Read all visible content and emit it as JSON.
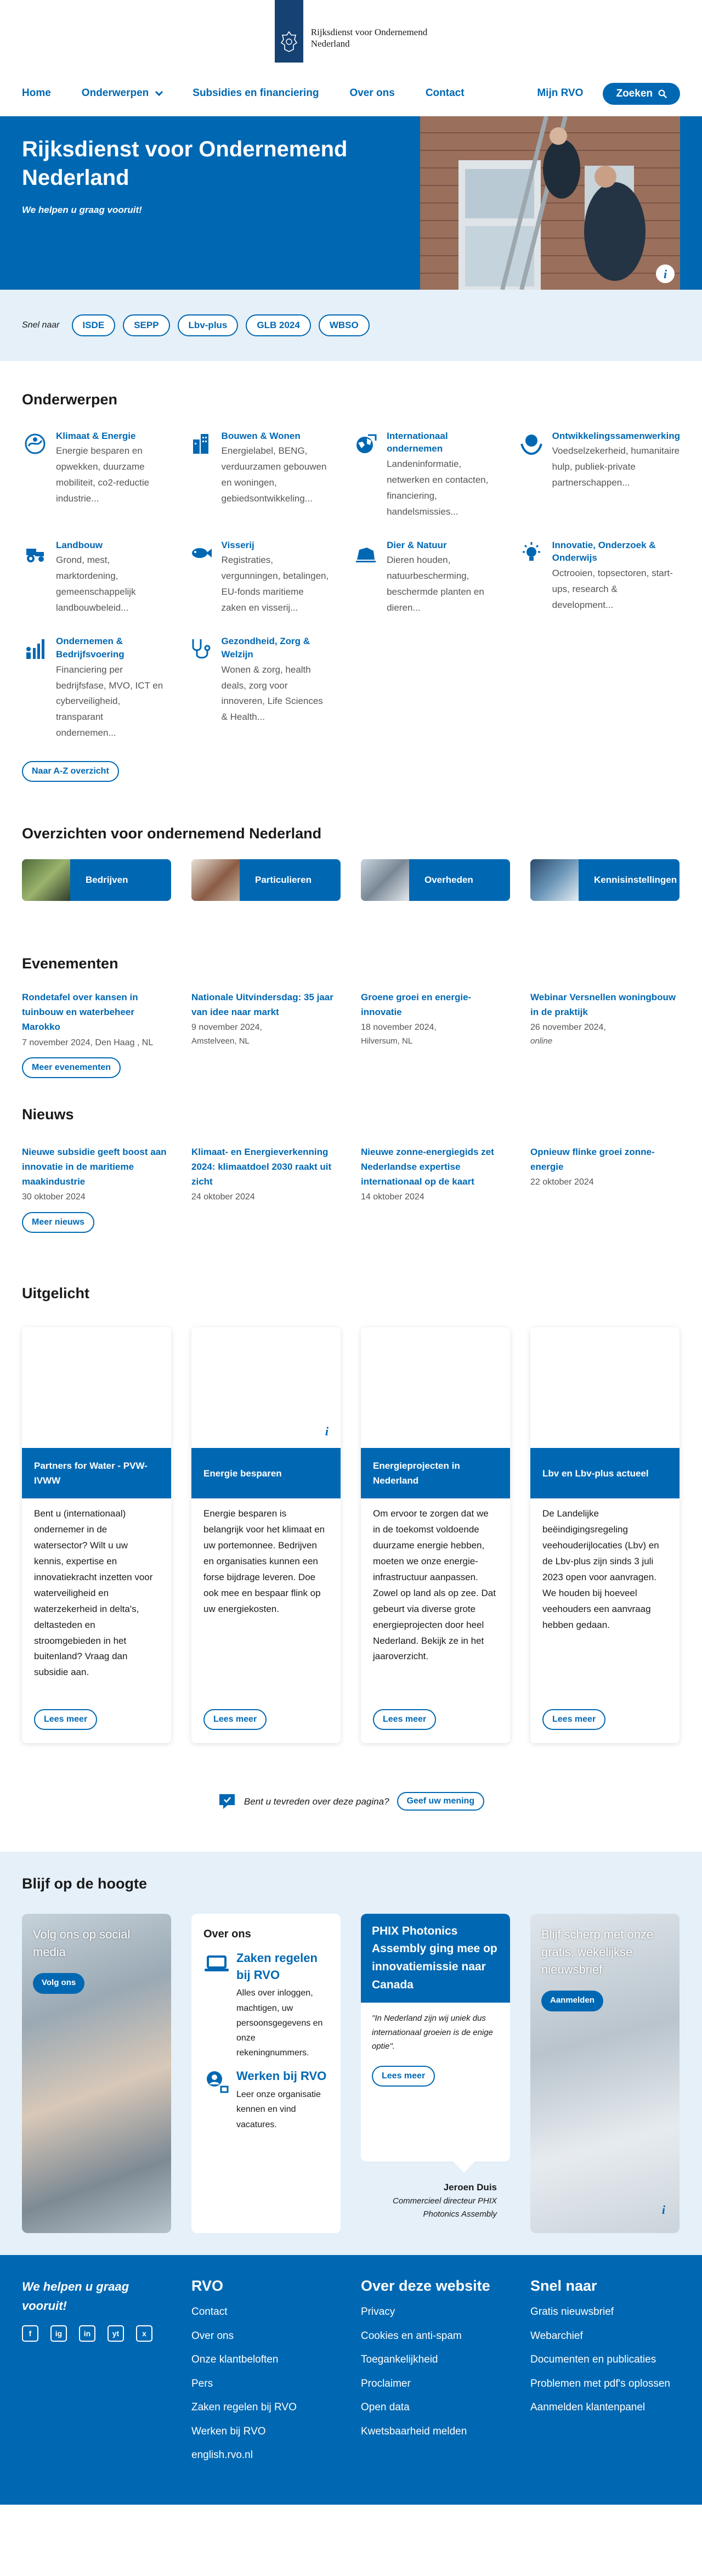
{
  "logo": {
    "line1": "Rijksdienst voor Ondernemend",
    "line2": "Nederland"
  },
  "nav": {
    "items": [
      "Home",
      "Onderwerpen",
      "Subsidies en financiering",
      "Over ons",
      "Contact"
    ],
    "mijn": "Mijn RVO",
    "search": "Zoeken"
  },
  "hero": {
    "title": "Rijksdienst voor Ondernemend Nederland",
    "subtitle": "We helpen u graag vooruit!"
  },
  "snel": {
    "label": "Snel naar",
    "chips": [
      "ISDE",
      "SEPP",
      "Lbv-plus",
      "GLB 2024",
      "WBSO"
    ]
  },
  "topics": {
    "heading": "Onderwerpen",
    "items": [
      {
        "title": "Klimaat & Energie",
        "text": "Energie besparen en opwekken, duurzame mobiliteit, co2-reductie industrie...",
        "icon": "climate-icon"
      },
      {
        "title": "Bouwen & Wonen",
        "text": "Energielabel, BENG, verduurzamen gebouwen en woningen, gebiedsontwikkeling...",
        "icon": "building-icon"
      },
      {
        "title": "Internationaal ondernemen",
        "text": "Landeninformatie, netwerken en contacten, financiering, handelsmissies...",
        "icon": "globe-icon"
      },
      {
        "title": "Ontwikkelingssamenwerking",
        "text": "Voedselzekerheid, humanitaire hulp, publiek-private partnerschappen...",
        "icon": "handshake-globe-icon"
      },
      {
        "title": "Landbouw",
        "text": "Grond, mest, marktordening, gemeenschappelijk landbouwbeleid...",
        "icon": "tractor-icon"
      },
      {
        "title": "Visserij",
        "text": "Registraties, vergunningen, betalingen, EU-fonds maritieme zaken en visserij...",
        "icon": "fish-icon"
      },
      {
        "title": "Dier & Natuur",
        "text": "Dieren houden, natuurbescherming, beschermde planten en dieren...",
        "icon": "animal-icon"
      },
      {
        "title": "Innovatie, Onderzoek & Onderwijs",
        "text": "Octrooien, topsectoren, start-ups, research & development...",
        "icon": "lightbulb-icon"
      },
      {
        "title": "Ondernemen & Bedrijfsvoering",
        "text": "Financiering per bedrijfsfase, MVO, ICT en cyberveiligheid, transparant ondernemen...",
        "icon": "chart-people-icon"
      },
      {
        "title": "Gezondheid, Zorg & Welzijn",
        "text": "Wonen & zorg, health deals, zorg voor innoveren, Life Sciences & Health...",
        "icon": "stethoscope-icon"
      }
    ],
    "more": "Naar A-Z overzicht"
  },
  "overzichten": {
    "heading": "Overzichten voor ondernemend Nederland",
    "items": [
      "Bedrijven",
      "Particulieren",
      "Overheden",
      "Kennisinstellingen"
    ]
  },
  "events": {
    "heading": "Evenementen",
    "items": [
      {
        "title": "Rondetafel over kansen in tuinbouw en waterbeheer Marokko",
        "date": "7 november 2024, Den Haag , NL",
        "loc": "",
        "italic": false
      },
      {
        "title": "Nationale Uitvindersdag: 35 jaar van idee naar markt",
        "date": "9 november 2024,",
        "loc": "Amstelveen, NL",
        "italic": false
      },
      {
        "title": "Groene groei en energie-innovatie",
        "date": "18 november 2024,",
        "loc": "Hilversum, NL",
        "italic": false
      },
      {
        "title": "Webinar Versnellen woningbouw in de praktijk",
        "date": "26 november 2024,",
        "loc": "online",
        "italic": true
      }
    ],
    "more": "Meer evenementen"
  },
  "news": {
    "heading": "Nieuws",
    "items": [
      {
        "title": "Nieuwe subsidie geeft boost aan innovatie in de maritieme maakindustrie",
        "date": "30 oktober 2024"
      },
      {
        "title": "Klimaat- en Energieverkenning 2024: klimaatdoel 2030 raakt uit zicht",
        "date": "24 oktober 2024"
      },
      {
        "title": "Nieuwe zonne-energiegids zet Nederlandse expertise internationaal op de kaart",
        "date": "14 oktober 2024"
      },
      {
        "title": "Opnieuw flinke groei zonne-energie",
        "date": "22 oktober 2024"
      }
    ],
    "more": "Meer nieuws"
  },
  "featured": {
    "heading": "Uitgelicht",
    "items": [
      {
        "title": "Partners for Water - PVW-IVWW",
        "text": "Bent u (internationaal) ondernemer in de watersector? Wilt u uw kennis, expertise en innovatiekracht inzetten voor waterveiligheid en waterzekerheid in delta's, deltasteden en stroomgebieden in het buitenland? Vraag dan subsidie aan.",
        "more": "Lees meer"
      },
      {
        "title": "Energie besparen",
        "text": "Energie besparen is belangrijk voor het klimaat en uw portemonnee. Bedrijven en organisaties kunnen een forse bijdrage leveren. Doe ook mee en bespaar flink op uw energiekosten.",
        "more": "Lees meer"
      },
      {
        "title": "Energieprojecten in Nederland",
        "text": "Om ervoor te zorgen dat we in de toekomst voldoende duurzame energie hebben, moeten we onze energie-infrastructuur aanpassen. Zowel op land als op zee. Dat gebeurt via diverse grote energieprojecten door heel Nederland. Bekijk ze in het jaaroverzicht.",
        "more": "Lees meer"
      },
      {
        "title": "Lbv en Lbv-plus actueel",
        "text": "De Landelijke beëindigingsregeling veehouderijlocaties (Lbv) en de Lbv-plus zijn sinds 3 juli 2023 open voor aanvragen. We houden bij hoeveel veehouders een aanvraag hebben gedaan.",
        "more": "Lees meer"
      }
    ]
  },
  "feedback": {
    "question": "Bent u tevreden over deze pagina?",
    "button": "Geef uw mening"
  },
  "blijf": {
    "heading": "Blijf op de hoogte",
    "social_title": "Volg ons op social media",
    "social_btn": "Volg ons",
    "over_title": "Over ons",
    "over_links": [
      {
        "title": "Zaken regelen bij RVO",
        "text": "Alles over inloggen, machtigen, uw persoonsgegevens en onze rekeningnummers.",
        "icon": "laptop-icon"
      },
      {
        "title": "Werken bij RVO",
        "text": "Leer onze organisatie kennen en vind vacatures.",
        "icon": "person-globe-icon"
      }
    ],
    "quote_title": "PHIX Photonics Assembly ging mee op innovatiemissie naar Canada",
    "quote_text": "\"In Nederland zijn wij uniek dus internationaal groeien is de enige optie\".",
    "quote_btn": "Lees meer",
    "quote_author": "Jeroen Duis",
    "quote_role": "Commercieel directeur PHIX Photonics Assembly",
    "news_title": "Blijf scherp met onze gratis, wekelijkse nieuwsbrief",
    "news_btn": "Aanmelden"
  },
  "footer": {
    "tagline": "We helpen u graag vooruit!",
    "social": [
      "f",
      "ig",
      "in",
      "yt",
      "x"
    ],
    "cols": [
      {
        "title": "RVO",
        "links": [
          "Contact",
          "Over ons",
          "Onze klantbeloften",
          "Pers",
          "Zaken regelen bij RVO",
          "Werken bij RVO",
          "english.rvo.nl"
        ]
      },
      {
        "title": "Over deze website",
        "links": [
          "Privacy",
          "Cookies en anti-spam",
          "Toegankelijkheid",
          "Proclaimer",
          "Open data",
          "Kwetsbaarheid melden"
        ]
      },
      {
        "title": "Snel naar",
        "links": [
          "Gratis nieuwsbrief",
          "Webarchief",
          "Documenten en publicaties",
          "Problemen met pdf's oplossen",
          "Aanmelden klantenpanel"
        ]
      }
    ]
  },
  "colors": {
    "brand": "#0068b3",
    "logo": "#154273",
    "light": "#e5f0f9"
  }
}
